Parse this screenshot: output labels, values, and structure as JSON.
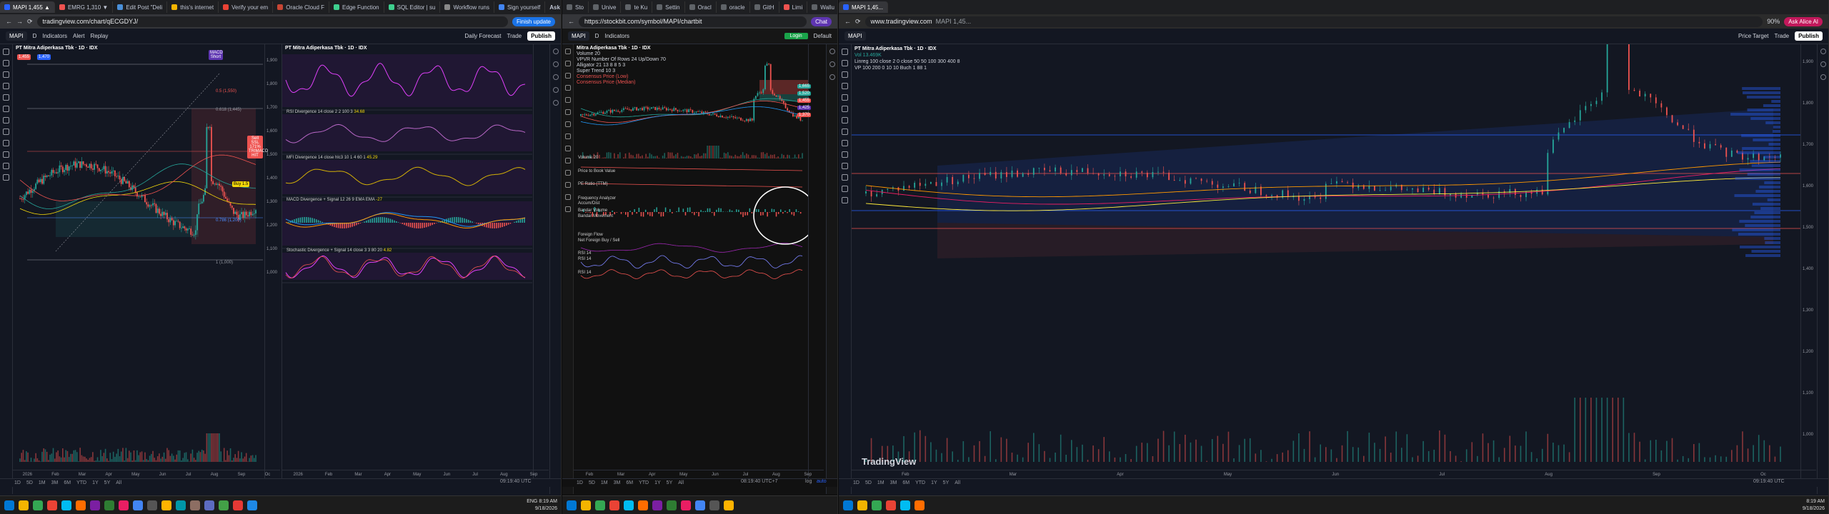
{
  "colors": {
    "up": "#26a69a",
    "down": "#ef5350",
    "bg": "#131722",
    "accent": "#2962ff",
    "stockbit_green": "#1aa34a"
  },
  "win1": {
    "tabs": [
      {
        "label": "MAPI 1,455 ▲",
        "active": true,
        "color": "#2962ff"
      },
      {
        "label": "EMRG 1,310 ▼",
        "active": false,
        "color": "#ef5350"
      },
      {
        "label": "Edit Post \"Deli",
        "active": false,
        "color": "#4a90d9"
      },
      {
        "label": "this's internet",
        "active": false,
        "color": "#f4b400"
      },
      {
        "label": "Verify your em",
        "active": false,
        "color": "#ea4335"
      },
      {
        "label": "Oracle Cloud F",
        "active": false,
        "color": "#c74634"
      },
      {
        "label": "Edge Function",
        "active": false,
        "color": "#3ecf8e"
      },
      {
        "label": "SQL Editor | su",
        "active": false,
        "color": "#3ecf8e"
      },
      {
        "label": "Workflow runs",
        "active": false,
        "color": "#888888"
      },
      {
        "label": "Sign yourself",
        "active": false,
        "color": "#4285f4"
      }
    ],
    "ask_gemini": "Ask Gemini",
    "url": "tradingview.com/chart/qECGDYJ/",
    "finish_update": "Finish update",
    "symbol": "MAPI",
    "interval": "D",
    "indicators": "Indicators",
    "alert": "Alert",
    "replay": "Replay",
    "daily_forecast": "Daily Forecast",
    "trade": "Trade",
    "publish": "Publish",
    "left_chart": {
      "title": "PT Mitra Adiperkasa Tbk · 1D · IDX",
      "price_low": "1,455",
      "price_high": "1,470",
      "idx_label": "IDX",
      "macd_tag": "MACD Short",
      "sell_tag": "Sell SSL 171% TRIMACD HIT",
      "buy_tag": "Buy 1.5",
      "fib_labels": [
        "0.786 (1,200)",
        "1 (1,000)",
        "0.618 (1,445)",
        "0.5 (1,550)"
      ],
      "x_labels": [
        "2026",
        "Feb",
        "Mar",
        "Apr",
        "May",
        "Jun",
        "Jul",
        "Aug",
        "Sep",
        "Oc"
      ],
      "price_ticks": [
        "1,900",
        "1,800",
        "1,700",
        "1,600",
        "1,500",
        "1,400",
        "1,300",
        "1,200",
        "1,100",
        "1,000"
      ]
    },
    "right_chart": {
      "title": "PT Mitra Adiperkasa Tbk · 1D · IDX",
      "panels": [
        {
          "label": "RSI Divergence 14 close 2 2 100 3",
          "value": "34.68",
          "tags": [
            "Bull",
            "Bear"
          ]
        },
        {
          "label": "MFI Divergence 14 close hlc3 10 1 4 60 1",
          "value": "45.29",
          "tags": [
            "Bull",
            "Bear"
          ]
        },
        {
          "label": "MACD Divergence + Signal 12 26 9 EMA EMA",
          "value": "-27",
          "tags": []
        },
        {
          "label": "Stochastic Divergence + Signal 14 close 3 3 80 20",
          "value": "4.82",
          "tags": [
            "Bear",
            "Bull"
          ]
        }
      ],
      "x_labels": [
        "2026",
        "Feb",
        "Mar",
        "Apr",
        "May",
        "Jun",
        "Jul",
        "Aug",
        "Sep"
      ],
      "time": "09:19:40 UTC",
      "adj": "ADJ"
    },
    "bottom_tf": [
      "1D",
      "5D",
      "1M",
      "3M",
      "6M",
      "YTD",
      "1Y",
      "5Y",
      "All"
    ],
    "taskbar_time": "8:19 AM",
    "taskbar_date": "9/18/2026",
    "lang": "ENG"
  },
  "win2": {
    "url": "https://stockbit.com/symbol/MAPI/chartbit",
    "tabs": [
      "Sto",
      "Unive",
      "te Ku",
      "Settin",
      "Oracl",
      "oracle",
      "GitH",
      "Limi",
      "Wallu"
    ],
    "chat": "Chat",
    "symbol": "MAPI",
    "interval": "D",
    "indicators": "Indicators",
    "login": "Login",
    "default": "Default",
    "title": "Mitra Adiperkasa Tbk · 1D · IDX",
    "lines": [
      "Volume 20",
      "VPVR Number Of Rows 24 Up/Down 70",
      "Alligator 21 13 8 8 5 3",
      "Super Trend 10 3",
      "Consensus Price (Low)",
      "Consensus Price (Median)"
    ],
    "subpanels": [
      "Volume 20",
      "Price to Book Value",
      "PE Ratio (TTM)",
      "Frequency Analyzer",
      "Accum/Dist",
      "Bandar Volume",
      "Bandar Movement",
      "Foreign Flow",
      "Net Foreign Buy / Sell",
      "RSI 14",
      "RSI 14",
      "RSI 14"
    ],
    "x_labels": [
      "Feb",
      "Mar",
      "Apr",
      "May",
      "Jun",
      "Jul",
      "Aug",
      "Sep"
    ],
    "bottom_tf": [
      "1D",
      "5D",
      "1M",
      "3M",
      "6M",
      "YTD",
      "1Y",
      "5Y",
      "All"
    ],
    "time": "08:19:40 UTC+7",
    "log": "log",
    "auto": "auto",
    "price_tags": [
      "1,665",
      "1,520",
      "1,455",
      "1,425",
      "1,370"
    ]
  },
  "win3": {
    "url": "www.tradingview.com",
    "tab_title": "MAPI 1,45...",
    "zoom": "90%",
    "ask": "Ask Alice AI",
    "symbol": "MAPI",
    "price_target": "Price Target",
    "trade": "Trade",
    "publish": "Publish",
    "title": "PT Mitra Adiperkasa Tbk · 1D · IDX",
    "legend2": "Vol 13.469K",
    "legend3": "Linreg 100 close 2 0 close 50 50 100 300 400 8",
    "legend4": "VP 100 200 0 10 10 Buch 1 88 1",
    "price_ticks": [
      "1,900",
      "1,800",
      "1,700",
      "1,600",
      "1,500",
      "1,400",
      "1,300",
      "1,200",
      "1,100",
      "1,000"
    ],
    "x_labels": [
      "Feb",
      "Mar",
      "Apr",
      "May",
      "Jun",
      "Jul",
      "Aug",
      "Sep",
      "Oc"
    ],
    "brand": "TradingView",
    "bottom_tf": [
      "1D",
      "5D",
      "1M",
      "3M",
      "6M",
      "YTD",
      "1Y",
      "5Y",
      "All"
    ],
    "time": "09:19:40 UTC",
    "taskbar_time": "8:19 AM",
    "taskbar_date": "9/18/2026"
  }
}
